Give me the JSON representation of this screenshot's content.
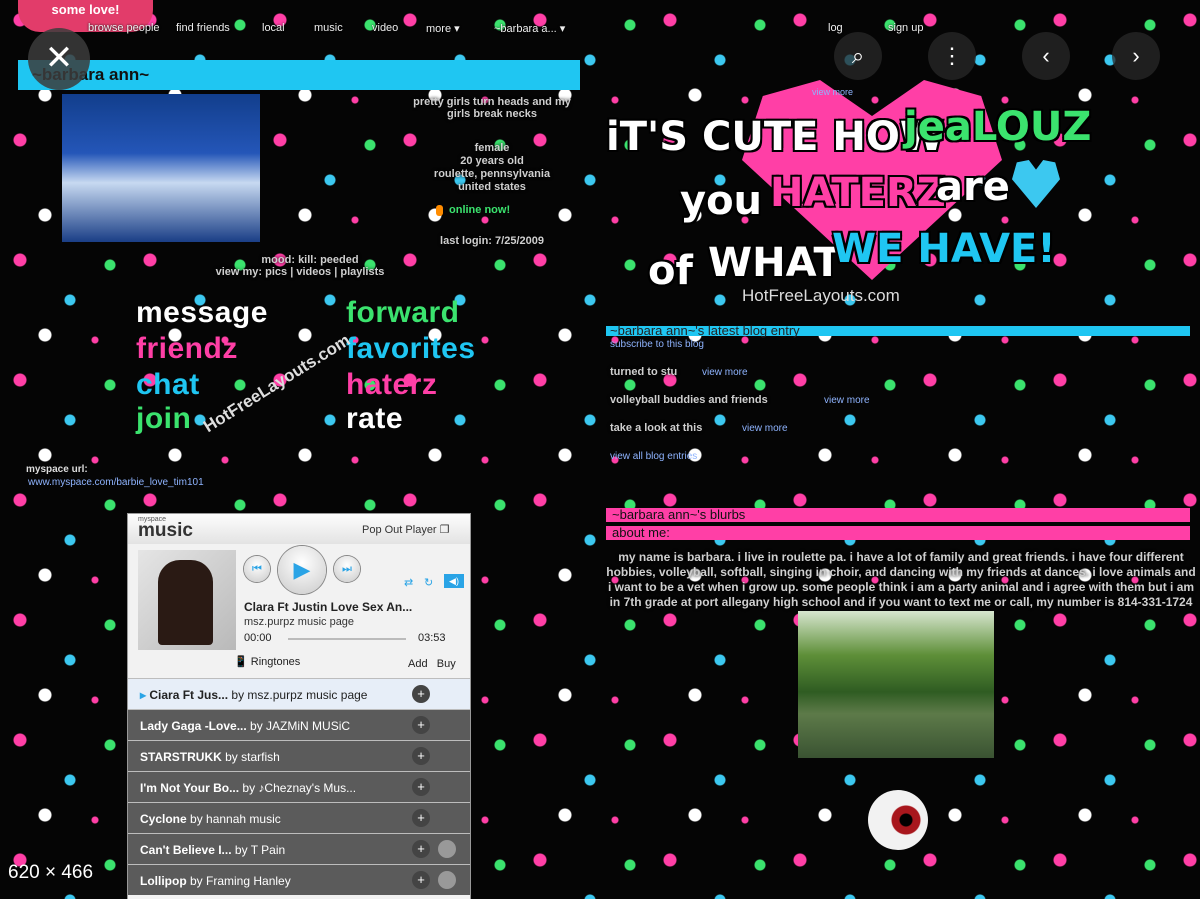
{
  "viewer": {
    "close_icon": "close-icon",
    "lens_icon": "lens-icon",
    "more_icon": "more-vertical-icon",
    "prev_icon": "chevron-left-icon",
    "next_icon": "chevron-right-icon",
    "dimensions": "620 × 466"
  },
  "myspace": {
    "logo_text": "some love!",
    "nav": [
      "browse people",
      "find friends",
      "local",
      "music",
      "video",
      "more ▾",
      "~barbara a... ▾",
      "log",
      "sign up"
    ],
    "profile": {
      "name": "~barbara ann~",
      "headline": "pretty girls turn heads and my girls break necks",
      "gender": "female",
      "age": "20 years old",
      "location": "roulette, pennsylvania",
      "country": "united states",
      "online": "online now!",
      "last_login": "last login: 7/25/2009",
      "mood": "mood: kill: peeded",
      "view_my": "view my: pics | videos | playlists"
    },
    "contact": {
      "left": [
        "message",
        "friendz",
        "chat",
        "join"
      ],
      "right": [
        "forward",
        "favorites",
        "haterz",
        "rate"
      ],
      "watermark": "HotFreeLayouts.com"
    },
    "myspace_url": {
      "label": "myspace url:",
      "value": "www.myspace.com/barbie_love_tim101"
    },
    "banner": {
      "line1a": "iT'S CUTE HOW",
      "line1b": "jeaLOUZ",
      "line2a": "you",
      "line2b": "HATERZ",
      "line2c": "are",
      "line3a": "of",
      "line3b": "WHAT",
      "line3c": "WE HAVE!",
      "credit": "HotFreeLayouts.com",
      "view_more": "view more"
    },
    "blog": {
      "title": "~barbara ann~'s latest blog entry",
      "subscribe": "subscribe to this blog",
      "entries": [
        {
          "title": "turned to stu",
          "link": "view more"
        },
        {
          "title": "volleyball buddies and friends",
          "link": "view more"
        },
        {
          "title": "take a look at this",
          "link": "view more"
        }
      ],
      "all_entries": "view all blog entries"
    },
    "blurbs": {
      "title": "~barbara ann~'s blurbs",
      "about": "about me:",
      "about_text": "my name is barbara. i live in roulette pa. i have a lot of family and great friends. i have four different hobbies, volleyball, softball, singing in choir, and dancing with my friends at dances. i love animals and i want to be a vet when i grow up. some people think i am a party animal and i agree with them but i am in 7th grade at port allegany high school and if you want to text me or call, my number is 814-331-1724"
    }
  },
  "player": {
    "brand": "music",
    "brand_prefix": "myspace",
    "popout": "Pop Out Player",
    "now_playing": "Clara Ft Justin Love Sex An...",
    "now_sub": "msz.purpz music page",
    "time_start": "00:00",
    "time_end": "03:53",
    "ringtones": "Ringtones",
    "add": "Add",
    "buy": "Buy",
    "tracks": [
      {
        "title": "Ciara Ft Jus...",
        "by": "by msz.purpz music page"
      },
      {
        "title": "Lady Gaga -Love...",
        "by": "by JAZMiN MUSiC"
      },
      {
        "title": "STARSTRUKK",
        "by": "by starfish"
      },
      {
        "title": "I'm Not Your Bo...",
        "by": "by ♪Cheznay's Mus..."
      },
      {
        "title": "Cyclone",
        "by": "by hannah music"
      },
      {
        "title": "Can't Believe I...",
        "by": "by T Pain"
      },
      {
        "title": "Lollipop",
        "by": "by Framing Hanley"
      }
    ]
  },
  "colors": {
    "pink": "#ff3fa6",
    "blue": "#1fc6f2",
    "green": "#3be36e"
  }
}
